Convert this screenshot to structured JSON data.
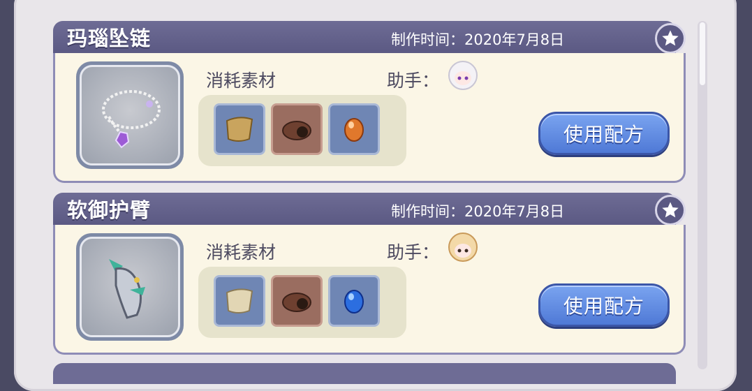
{
  "recipes": [
    {
      "name": "玛瑙坠链",
      "time_label": "制作时间：2020年7月8日",
      "materials_label": "消耗素材",
      "helper_label": "助手：",
      "use_button": "使用配方",
      "materials": [
        "leather-scroll-icon",
        "bracer-icon",
        "orange-gem-icon"
      ]
    },
    {
      "name": "软御护臂",
      "time_label": "制作时间：2020年7月8日",
      "materials_label": "消耗素材",
      "helper_label": "助手：",
      "use_button": "使用配方",
      "materials": [
        "paper-scroll-icon",
        "bracer-icon",
        "blue-gem-icon"
      ]
    }
  ],
  "colors": {
    "header": "#5b5983",
    "body": "#fbf6e6",
    "button": "#4f79d6"
  }
}
